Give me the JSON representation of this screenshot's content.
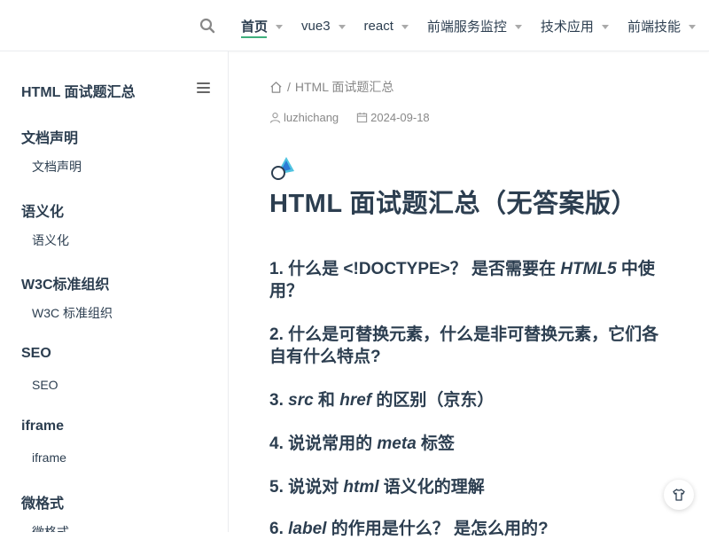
{
  "nav": {
    "items": [
      {
        "label": "首页",
        "active": true
      },
      {
        "label": "vue3",
        "active": false
      },
      {
        "label": "react",
        "active": false
      },
      {
        "label": "前端服务监控",
        "active": false
      },
      {
        "label": "技术应用",
        "active": false
      },
      {
        "label": "前端技能",
        "active": false
      }
    ]
  },
  "sidebar": {
    "title": "HTML 面试题汇总",
    "groups": [
      {
        "title": "文档声明",
        "link": "文档声明"
      },
      {
        "title": "语义化",
        "link": "语义化"
      },
      {
        "title": "W3C标准组织",
        "link": "W3C 标准组织"
      },
      {
        "title": "SEO",
        "link": "SEO"
      },
      {
        "title": "iframe",
        "link": "iframe"
      },
      {
        "title": "微格式",
        "link": "微格式"
      }
    ]
  },
  "breadcrumb": {
    "sep": "/",
    "current": "HTML 面试题汇总"
  },
  "meta": {
    "author": "luzhichang",
    "date": "2024-09-18"
  },
  "page": {
    "title": "HTML 面试题汇总（无答案版）",
    "questions": [
      {
        "parts": [
          "1. 什么是 <!DOCTYPE>？ 是否需要在 ",
          "HTML5",
          " 中使用？"
        ]
      },
      {
        "parts": [
          "2. 什么是可替换元素，什么是非可替换元素，它们各自有什么特点?"
        ]
      },
      {
        "parts": [
          "3. ",
          "src",
          " 和 ",
          "href",
          " 的区别（京东）"
        ]
      },
      {
        "parts": [
          "4. 说说常用的 ",
          "meta",
          " 标签"
        ]
      },
      {
        "parts": [
          "5. 说说对 ",
          "html",
          " 语义化的理解"
        ]
      },
      {
        "parts": [
          "6. ",
          "label",
          " 的作用是什么？ 是怎么用的?"
        ]
      }
    ]
  },
  "colors": {
    "accent": "#3eaf7c",
    "text": "#2c3e50",
    "muted": "#888888"
  },
  "icons": {
    "search": "search-icon",
    "menu": "menu-icon",
    "home": "home-icon",
    "user": "user-icon",
    "calendar": "calendar-icon",
    "float": "shirt-icon"
  }
}
